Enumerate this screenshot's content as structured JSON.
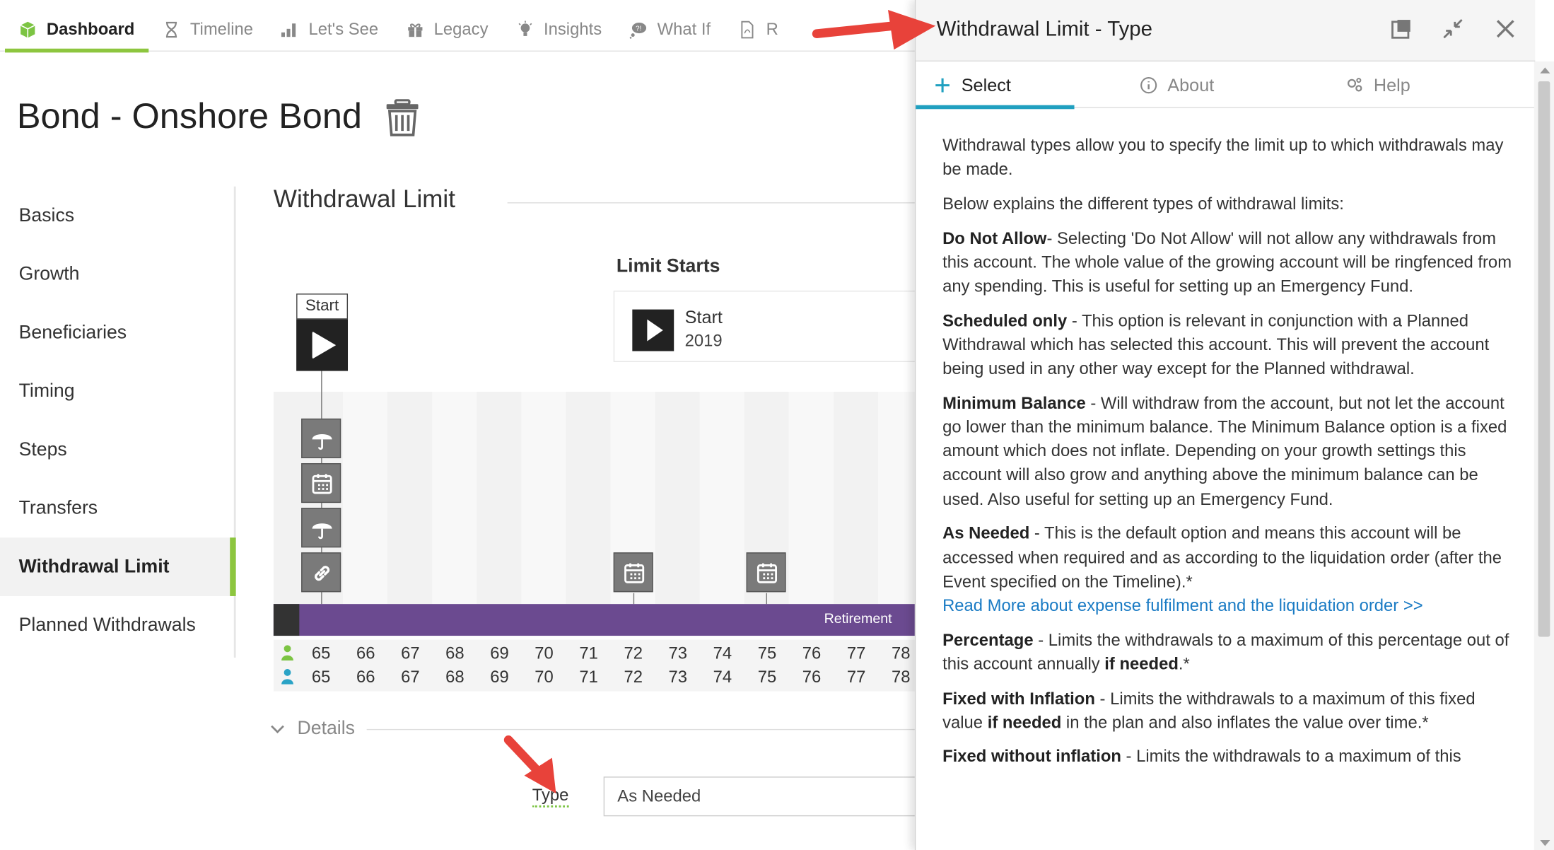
{
  "topnav": {
    "tabs": [
      {
        "label": "Dashboard",
        "icon": "cube-icon",
        "active": true
      },
      {
        "label": "Timeline",
        "icon": "hourglass-icon"
      },
      {
        "label": "Let's See",
        "icon": "bar-chart-icon"
      },
      {
        "label": "Legacy",
        "icon": "gift-icon"
      },
      {
        "label": "Insights",
        "icon": "lightbulb-icon"
      },
      {
        "label": "What If",
        "icon": "thought-bubble-icon"
      },
      {
        "label": "R",
        "icon": "pdf-icon"
      }
    ]
  },
  "page": {
    "title": "Bond - Onshore Bond"
  },
  "leftnav": {
    "items": [
      "Basics",
      "Growth",
      "Beneficiaries",
      "Timing",
      "Steps",
      "Transfers",
      "Withdrawal Limit",
      "Planned Withdrawals"
    ],
    "active": "Withdrawal Limit"
  },
  "main": {
    "section_title": "Withdrawal Limit",
    "limit_starts": {
      "heading": "Limit Starts",
      "label": "Start",
      "year": "2019"
    },
    "start_marker_label": "Start",
    "bar_label": "Retirement",
    "ages_row1": [
      "65",
      "66",
      "67",
      "68",
      "69",
      "70",
      "71",
      "72",
      "73",
      "74",
      "75",
      "76",
      "77",
      "78"
    ],
    "ages_row2": [
      "65",
      "66",
      "67",
      "68",
      "69",
      "70",
      "71",
      "72",
      "73",
      "74",
      "75",
      "76",
      "77",
      "78"
    ],
    "details_label": "Details",
    "type_label": "Type",
    "type_value": "As Needed"
  },
  "panel": {
    "title": "Withdrawal Limit - Type",
    "tabs": {
      "select": "Select",
      "about": "About",
      "help": "Help"
    },
    "intro1": "Withdrawal types allow you to specify the limit up to which withdrawals may be made.",
    "intro2": "Below explains the different types of withdrawal limits:",
    "items": [
      {
        "term": "Do Not Allow",
        "text": "- Selecting 'Do Not Allow' will not allow any withdrawals from this account. The whole value of the growing account will be ringfenced from any spending. This is useful for setting up an Emergency Fund."
      },
      {
        "term": "Scheduled only",
        "text": " - This option is relevant in conjunction with a Planned Withdrawal which has selected this account. This will prevent the account being used in any other way except for the Planned withdrawal."
      },
      {
        "term": "Minimum Balance",
        "text": " - Will withdraw from the account, but not let the account go lower than the minimum balance. The Minimum Balance option is a fixed amount which does not inflate. Depending on your growth settings this account will also grow and anything above the minimum balance can be used. Also useful for setting up an Emergency Fund."
      },
      {
        "term": "As Needed",
        "text": " - This is the default option and means this account will be accessed when required and as according to the liquidation order (after the Event specified on the Timeline).*"
      }
    ],
    "read_more": "Read More about expense fulfilment and the liquidation order >>",
    "percentage": {
      "term": "Percentage",
      "text": " - Limits the withdrawals to a maximum of this percentage out of this account annually ",
      "bold2": "if needed",
      "tail": ".*"
    },
    "fixed_infl": {
      "term": "Fixed with Inflation",
      "text": " - Limits the withdrawals to a maximum of this fixed value ",
      "bold2": "if needed",
      "tail": " in the plan and also inflates the value over time.*"
    },
    "fixed_noinfl": {
      "term": "Fixed without inflation",
      "text": " - Limits the withdrawals to a maximum of this"
    }
  },
  "colors": {
    "accent_green": "#8dc63f",
    "retirement_bar": "#6b4a90",
    "tab_underline": "#20a0c0",
    "arrow": "#e8423a",
    "link": "#1a7bc4"
  }
}
